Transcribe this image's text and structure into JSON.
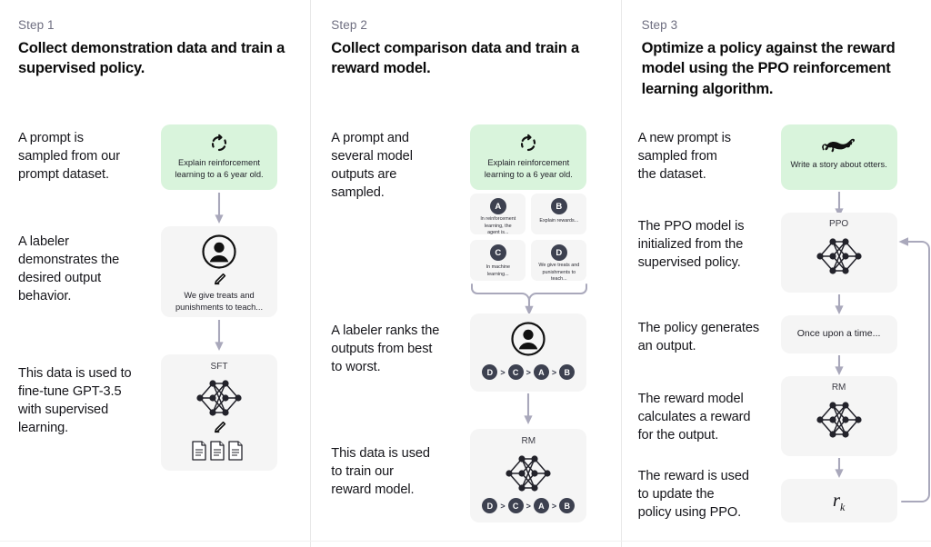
{
  "columns": [
    {
      "step_label": "Step 1",
      "title": "Collect demonstration data\nand train a supervised policy.",
      "captions": [
        "A prompt is\nsampled from our\nprompt dataset.",
        "A labeler\ndemonstrates the\ndesired output\nbehavior.",
        "This data is used to\nfine-tune GPT-3.5\nwith supervised\nlearning."
      ],
      "cards": [
        {
          "name": "prompt-card",
          "icon": "cycle-icon",
          "text": "Explain reinforcement\nlearning to a 6 year old.",
          "style": "green"
        },
        {
          "name": "labeler-card",
          "icon": "person-circle-icon",
          "text": "We give treats and\npunishments to teach...",
          "style": "grey"
        },
        {
          "name": "sft-card",
          "icon": "neural-net-icon",
          "title": "SFT",
          "text": "",
          "style": "grey"
        }
      ]
    },
    {
      "step_label": "Step 2",
      "title": "Collect comparison data and\ntrain a reward model.",
      "captions": [
        "A prompt and\nseveral model\noutputs are\nsampled.",
        "A labeler ranks the\noutputs from best\nto worst.",
        "This data is used\nto train our\nreward model."
      ],
      "cards": [
        {
          "name": "prompt-card",
          "icon": "cycle-icon",
          "text": "Explain reinforcement\nlearning to a 6 year old.",
          "style": "green"
        },
        {
          "name": "ranking-card",
          "icon": "person-circle-icon",
          "text": "",
          "style": "grey"
        },
        {
          "name": "rm-card",
          "icon": "neural-net-icon",
          "title": "RM",
          "text": "",
          "style": "grey"
        }
      ],
      "outputs": [
        {
          "badge": "A",
          "text": "In reinforcement\nlearning, the\nagent is..."
        },
        {
          "badge": "B",
          "text": "Explain rewards..."
        },
        {
          "badge": "C",
          "text": "In machine\nlearning..."
        },
        {
          "badge": "D",
          "text": "We give treats and\npunishments to\nteach..."
        }
      ],
      "ranking": [
        "D",
        "C",
        "A",
        "B"
      ],
      "ranking_separator": ">"
    },
    {
      "step_label": "Step 3",
      "title": "Optimize a policy against the\nreward model using the PPO\nreinforcement learning algorithm.",
      "captions": [
        "A new prompt is\nsampled from\nthe dataset.",
        "The PPO model is\ninitialized from the\nsupervised policy.",
        "The policy generates\nan output.",
        "The reward model\ncalculates a reward\nfor the output.",
        "The reward is used\nto update the\npolicy using PPO."
      ],
      "cards": [
        {
          "name": "new-prompt-card",
          "icon": "otter-icon",
          "text": "Write a story\nabout otters.",
          "style": "green"
        },
        {
          "name": "ppo-card",
          "icon": "neural-net-icon",
          "title": "PPO",
          "text": "",
          "style": "grey"
        },
        {
          "name": "output-card",
          "icon": "none",
          "text": "Once upon a time...",
          "style": "grey"
        },
        {
          "name": "rm-card",
          "icon": "neural-net-icon",
          "title": "RM",
          "text": "",
          "style": "grey"
        },
        {
          "name": "reward-card",
          "icon": "none",
          "text": "r",
          "subscript": "k",
          "style": "grey"
        }
      ]
    }
  ],
  "colors": {
    "green_card": "#d9f4dc",
    "grey_card": "#f5f5f5",
    "arrow": "#a9a8bb",
    "badge": "#3d4150",
    "step_label": "#6e6e80",
    "divider": "#e8e8e8"
  }
}
